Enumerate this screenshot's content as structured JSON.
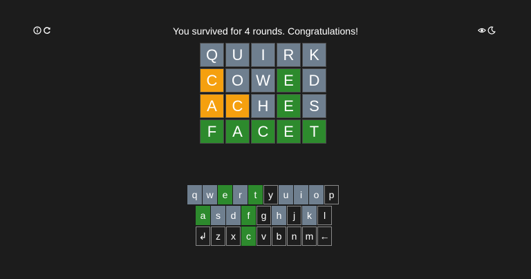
{
  "header": {
    "message": "You survived for 4 rounds. Congratulations!",
    "left_icons": [
      "info-icon",
      "restart-icon"
    ],
    "right_icons": [
      "eye-icon",
      "moon-icon"
    ]
  },
  "colors": {
    "background": "#1c1c1c",
    "absent": "#6f7f8f",
    "present": "#f5a00f",
    "correct": "#2d8a2d"
  },
  "board": [
    {
      "word": "QUIRK",
      "tiles": [
        {
          "letter": "Q",
          "state": "absent"
        },
        {
          "letter": "U",
          "state": "absent"
        },
        {
          "letter": "I",
          "state": "absent"
        },
        {
          "letter": "R",
          "state": "absent"
        },
        {
          "letter": "K",
          "state": "absent"
        }
      ]
    },
    {
      "word": "COWED",
      "tiles": [
        {
          "letter": "C",
          "state": "present"
        },
        {
          "letter": "O",
          "state": "absent"
        },
        {
          "letter": "W",
          "state": "absent"
        },
        {
          "letter": "E",
          "state": "correct"
        },
        {
          "letter": "D",
          "state": "absent"
        }
      ]
    },
    {
      "word": "ACHES",
      "tiles": [
        {
          "letter": "A",
          "state": "present"
        },
        {
          "letter": "C",
          "state": "present"
        },
        {
          "letter": "H",
          "state": "absent"
        },
        {
          "letter": "E",
          "state": "correct"
        },
        {
          "letter": "S",
          "state": "absent"
        }
      ]
    },
    {
      "word": "FACET",
      "tiles": [
        {
          "letter": "F",
          "state": "correct"
        },
        {
          "letter": "A",
          "state": "correct"
        },
        {
          "letter": "C",
          "state": "correct"
        },
        {
          "letter": "E",
          "state": "correct"
        },
        {
          "letter": "T",
          "state": "correct"
        }
      ]
    }
  ],
  "keyboard": {
    "rows": [
      [
        {
          "label": "q",
          "state": "absent"
        },
        {
          "label": "w",
          "state": "absent"
        },
        {
          "label": "e",
          "state": "correct"
        },
        {
          "label": "r",
          "state": "absent"
        },
        {
          "label": "t",
          "state": "correct"
        },
        {
          "label": "y",
          "state": "unused"
        },
        {
          "label": "u",
          "state": "absent"
        },
        {
          "label": "i",
          "state": "absent"
        },
        {
          "label": "o",
          "state": "absent"
        },
        {
          "label": "p",
          "state": "unused"
        }
      ],
      [
        {
          "label": "a",
          "state": "correct"
        },
        {
          "label": "s",
          "state": "absent"
        },
        {
          "label": "d",
          "state": "absent"
        },
        {
          "label": "f",
          "state": "correct"
        },
        {
          "label": "g",
          "state": "unused"
        },
        {
          "label": "h",
          "state": "absent"
        },
        {
          "label": "j",
          "state": "unused"
        },
        {
          "label": "k",
          "state": "absent"
        },
        {
          "label": "l",
          "state": "unused"
        }
      ],
      [
        {
          "label": "↲",
          "state": "unused",
          "name": "enter-key"
        },
        {
          "label": "z",
          "state": "unused"
        },
        {
          "label": "x",
          "state": "unused"
        },
        {
          "label": "c",
          "state": "correct"
        },
        {
          "label": "v",
          "state": "unused"
        },
        {
          "label": "b",
          "state": "unused"
        },
        {
          "label": "n",
          "state": "unused"
        },
        {
          "label": "m",
          "state": "unused"
        },
        {
          "label": "←",
          "state": "unused",
          "name": "backspace-key"
        }
      ]
    ]
  }
}
